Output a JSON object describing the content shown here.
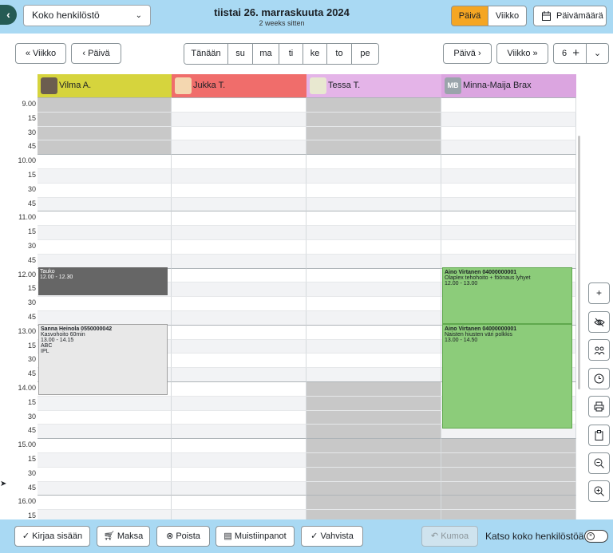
{
  "header": {
    "back_icon": "chevron-left-icon",
    "staff_select": "Koko henkilöstö",
    "date": "tiistai 26. marraskuuta 2024",
    "relative": "2 weeks sitten",
    "view_day": "Päivä",
    "view_week": "Viikko",
    "date_button": "Päivämäärä",
    "active_color": "#f5a623"
  },
  "nav": {
    "prev_week": "« Viikko",
    "prev_day": "‹ Päivä",
    "days": [
      "Tänään",
      "su",
      "ma",
      "ti",
      "ke",
      "to",
      "pe"
    ],
    "next_day": "Päivä ›",
    "next_week": "Viikko »",
    "zoom_value": "6",
    "plus": "+",
    "dropdown": "⌄"
  },
  "staff": [
    {
      "name": "Vilma A.",
      "color": "#d6d43d"
    },
    {
      "name": "Jukka T.",
      "color": "#f06d6b"
    },
    {
      "name": "Tessa T.",
      "color": "#e4b4e8"
    },
    {
      "name": "Minna-Maija Brax",
      "color": "#dba5e0",
      "initials": "MB"
    }
  ],
  "times": [
    "9.00",
    "15",
    "30",
    "45",
    "10.00",
    "15",
    "30",
    "45",
    "11.00",
    "15",
    "30",
    "45",
    "12.00",
    "15",
    "30",
    "45",
    "13.00",
    "15",
    "30",
    "45",
    "14.00",
    "15",
    "30",
    "45",
    "15.00",
    "15",
    "30",
    "45",
    "16.00",
    "15"
  ],
  "events": {
    "break": {
      "title": "Tauko",
      "time": "12.00 - 12.30"
    },
    "sanna": {
      "title": "Sanna Heinola 0550000042",
      "service": "Kasvohoito 60min",
      "time": "13.00 - 14.15",
      "extra1": "ABC",
      "extra2": "IPL"
    },
    "aino1": {
      "title": "Aino Virtanen 04000000001",
      "service": "Olaplex tehohoito + föönaus lyhyet",
      "time": "12.00 - 13.00"
    },
    "aino2": {
      "title": "Aino Virtanen 04000000001",
      "service": "Naisten hiusten väri polkkis",
      "time": "13.00 - 14.50"
    }
  },
  "side_icons": [
    "plus-icon",
    "eye-off-icon",
    "group-icon",
    "clock-icon",
    "print-icon",
    "clipboard-icon",
    "zoom-out-icon",
    "zoom-in-icon"
  ],
  "footer": {
    "checkin": "Kirjaa sisään",
    "pay": "Maksa",
    "delete": "Poista",
    "notes": "Muistiinpanot",
    "confirm": "Vahvista",
    "undo": "Kumoa",
    "all_staff": "Katso koko henkilöstöä"
  }
}
